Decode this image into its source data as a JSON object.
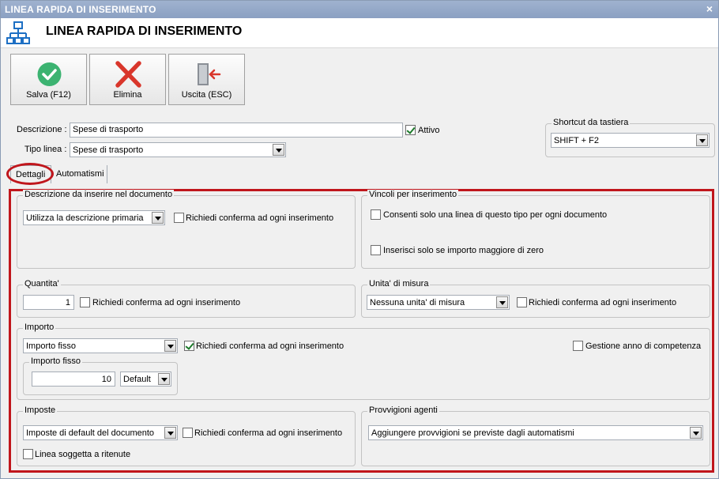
{
  "window": {
    "title": "LINEA RAPIDA DI INSERIMENTO",
    "close_label": "×"
  },
  "header": {
    "title": "LINEA RAPIDA DI INSERIMENTO",
    "icon": "hierarchy-icon"
  },
  "toolbar": {
    "save_label": "Salva (F12)",
    "delete_label": "Elimina",
    "exit_label": "Uscita (ESC)"
  },
  "form": {
    "descrizione_label": "Descrizione :",
    "descrizione_value": "Spese di trasporto",
    "attivo_label": "Attivo",
    "attivo_checked": true,
    "tipo_linea_label": "Tipo linea :",
    "tipo_linea_value": "Spese di trasporto"
  },
  "shortcut": {
    "label": "Shortcut da tastiera",
    "value": "SHIFT + F2"
  },
  "tabs": [
    {
      "label": "Dettagli",
      "active": true
    },
    {
      "label": "Automatismi",
      "active": false
    }
  ],
  "details": {
    "descr_doc": {
      "title": "Descrizione da inserire nel documento",
      "combo_value": "Utilizza la descrizione primaria",
      "confirm_label": "Richiedi conferma ad ogni inserimento"
    },
    "vincoli": {
      "title": "Vincoli per inserimento",
      "one_line_label": "Consenti solo una linea di questo tipo per ogni documento",
      "positive_label": "Inserisci solo se importo maggiore di zero"
    },
    "quantita": {
      "title": "Quantita'",
      "value": "1",
      "confirm_label": "Richiedi conferma ad ogni inserimento"
    },
    "unita": {
      "title": "Unita' di misura",
      "combo_value": "Nessuna unita' di misura",
      "confirm_label": "Richiedi conferma ad ogni inserimento"
    },
    "importo": {
      "title": "Importo",
      "combo_value": "Importo fisso",
      "confirm_label": "Richiedi conferma ad ogni inserimento",
      "confirm_checked": true,
      "competenza_label": "Gestione anno di competenza",
      "fixed_title": "Importo fisso",
      "fixed_value": "10",
      "fixed_combo": "Default"
    },
    "imposte": {
      "title": "Imposte",
      "combo_value": "Imposte di default del documento",
      "confirm_label": "Richiedi conferma ad ogni inserimento",
      "ritenute_label": "Linea soggetta a ritenute"
    },
    "provvigioni": {
      "title": "Provvigioni agenti",
      "combo_value": "Aggiungere provvigioni se previste dagli automatismi"
    }
  },
  "colors": {
    "highlight": "#c0161c",
    "title_bar": "#8ba0c2",
    "save_green": "#3cb371",
    "delete_red": "#d9362b"
  }
}
